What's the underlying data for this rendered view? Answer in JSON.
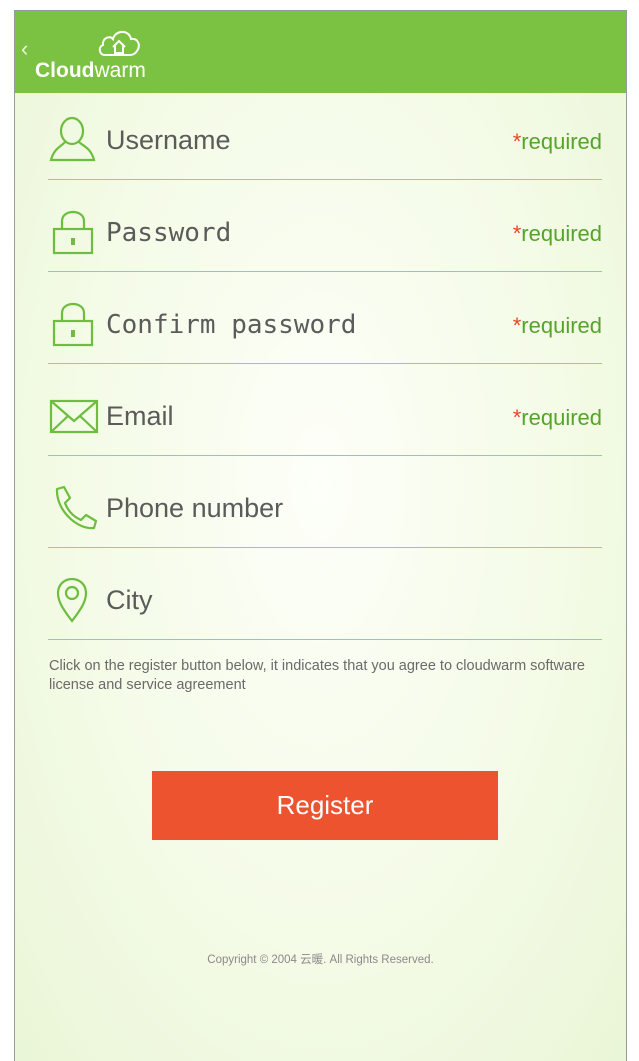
{
  "header": {
    "back_icon": "chevron-left-icon",
    "logo": {
      "bold_part": "Cloud",
      "light_part": "warm",
      "icon": "cloud-house-icon"
    }
  },
  "colors": {
    "header_green": "#7cc242",
    "required_green": "#55a52a",
    "required_star": "#e64524",
    "register_button": "#ec532e"
  },
  "form": {
    "fields": [
      {
        "icon": "user-icon",
        "label": "Username",
        "required": "required",
        "star": "*"
      },
      {
        "icon": "lock-icon",
        "label": "Password",
        "required": "required",
        "star": "*"
      },
      {
        "icon": "lock-icon",
        "label": "Confirm password",
        "required": "required",
        "star": "*"
      },
      {
        "icon": "envelope-icon",
        "label": "Email",
        "required": "required",
        "star": "*"
      },
      {
        "icon": "phone-icon",
        "label": "Phone number"
      },
      {
        "icon": "location-pin-icon",
        "label": "City"
      }
    ]
  },
  "agreement": "Click on the register button below, it indicates that you agree to cloudwarm software license and service agreement",
  "register_label": "Register",
  "copyright": "Copyright © 2004 云暖. All Rights Reserved."
}
